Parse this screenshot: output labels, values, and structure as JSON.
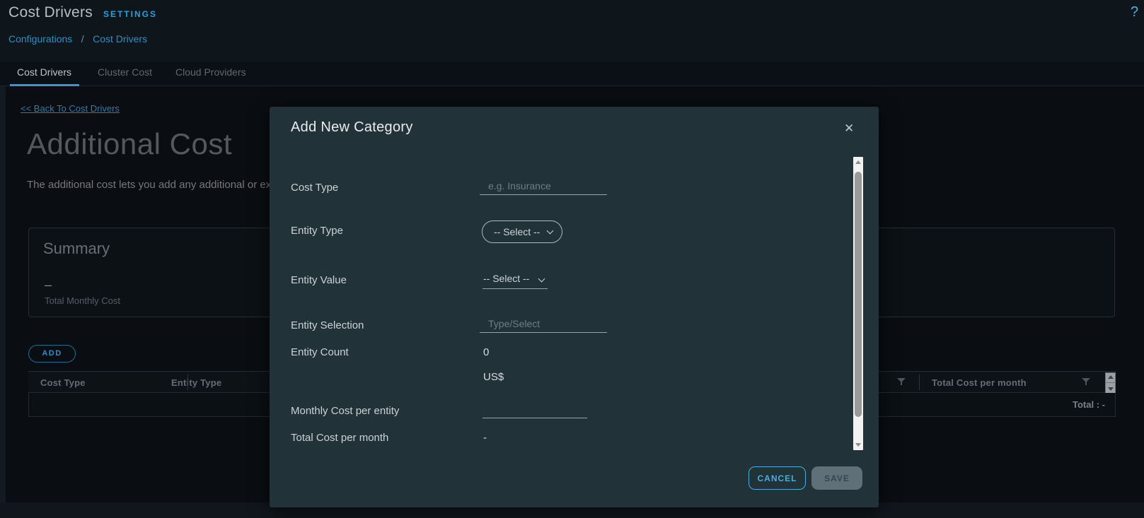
{
  "header": {
    "title": "Cost Drivers",
    "settings_label": "SETTINGS",
    "help_icon": "?",
    "breadcrumb": {
      "items": [
        "Configurations",
        "Cost Drivers"
      ],
      "separator": "/"
    }
  },
  "tabs": [
    {
      "label": "Cost Drivers",
      "active": true
    },
    {
      "label": "Cluster Cost",
      "active": false
    },
    {
      "label": "Cloud Providers",
      "active": false
    }
  ],
  "page": {
    "back_link": "<< Back To Cost Drivers",
    "title": "Additional Cost",
    "description": "The additional cost lets you add any additional or ex",
    "summary": {
      "title": "Summary",
      "value": "–",
      "label": "Total Monthly Cost"
    },
    "add_button": "ADD",
    "table": {
      "columns": [
        "Cost Type",
        "Entity Type",
        "Total Cost per month"
      ],
      "total_label": "Total : -"
    }
  },
  "modal": {
    "title": "Add New Category",
    "close_icon": "✕",
    "fields": {
      "cost_type": {
        "label": "Cost Type",
        "placeholder": "e.g. Insurance",
        "value": ""
      },
      "entity_type": {
        "label": "Entity Type",
        "value": "-- Select --"
      },
      "entity_value": {
        "label": "Entity Value",
        "value": "-- Select --"
      },
      "entity_selection": {
        "label": "Entity Selection",
        "placeholder": "Type/Select",
        "value": ""
      },
      "entity_count": {
        "label": "Entity Count",
        "value": "0"
      },
      "monthly_cost": {
        "label": "Monthly Cost per entity",
        "value": ""
      },
      "total_cost": {
        "label": "Total Cost per month",
        "value": "-"
      }
    },
    "currency": "US$",
    "buttons": {
      "cancel": "CANCEL",
      "save": "SAVE"
    }
  },
  "colors": {
    "accent_blue": "#49afd9",
    "modal_background": "#213238",
    "page_background": "#0a0e12",
    "header_background": "#0e161c",
    "dimmed_text": "#55595d"
  }
}
